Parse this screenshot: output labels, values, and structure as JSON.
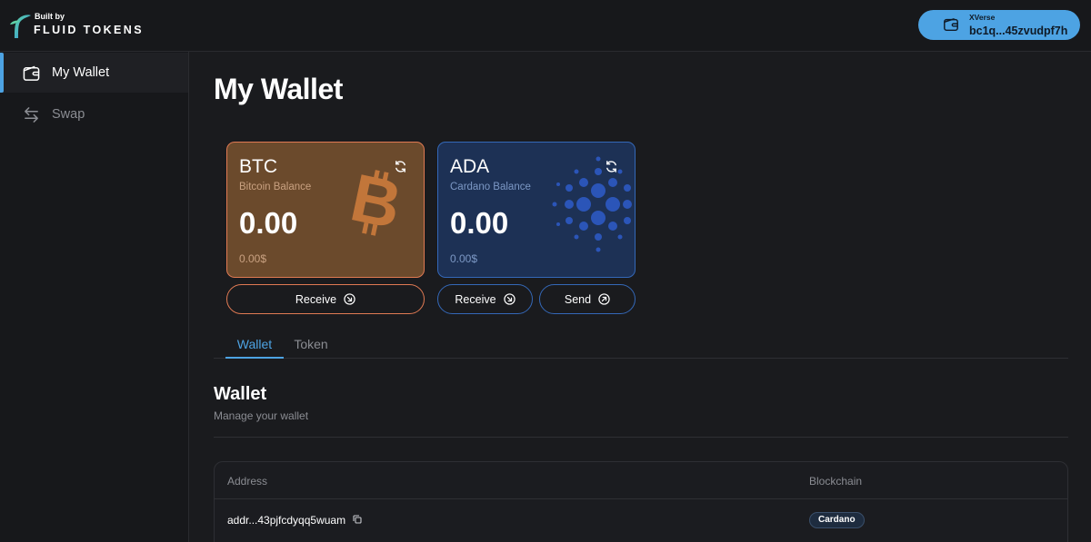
{
  "brand": {
    "built_by": "Built by",
    "name": "FLUID TOKENS"
  },
  "wallet_connection": {
    "provider": "XVerse",
    "address": "bc1q...45zvudpf7h"
  },
  "sidebar": {
    "items": [
      {
        "label": "My Wallet",
        "icon": "wallet-icon",
        "active": true
      },
      {
        "label": "Swap",
        "icon": "swap-arrows-icon",
        "active": false
      }
    ]
  },
  "page": {
    "title": "My Wallet"
  },
  "cards": {
    "btc": {
      "symbol": "BTC",
      "subtitle": "Bitcoin Balance",
      "balance": "0.00",
      "usd": "0.00$",
      "accent": "#e07a53",
      "watermark_icon": "bitcoin-logo-icon"
    },
    "ada": {
      "symbol": "ADA",
      "subtitle": "Cardano Balance",
      "balance": "0.00",
      "usd": "0.00$",
      "accent": "#3468b8",
      "watermark_icon": "cardano-logo-icon"
    }
  },
  "actions": {
    "btc_receive": "Receive",
    "ada_receive": "Receive",
    "ada_send": "Send"
  },
  "tabs": [
    {
      "label": "Wallet",
      "active": true
    },
    {
      "label": "Token",
      "active": false
    }
  ],
  "wallet_section": {
    "title": "Wallet",
    "subtitle": "Manage your wallet",
    "columns": [
      "Address",
      "Blockchain"
    ],
    "rows": [
      {
        "address": "addr...43pjfcdyqq5wuam",
        "blockchain": "Cardano"
      }
    ]
  },
  "colors": {
    "accent_blue": "#4da3e3",
    "background": "#1a1b1e"
  }
}
